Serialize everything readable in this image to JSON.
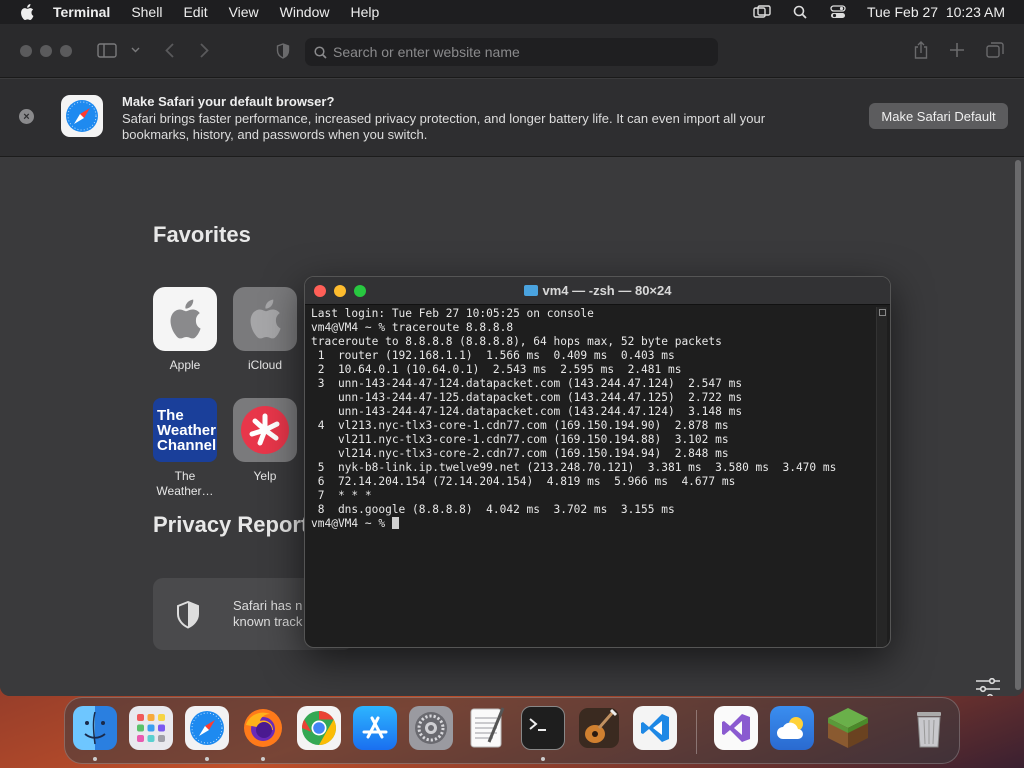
{
  "menubar": {
    "apple_icon": "apple-logo-icon",
    "items": [
      "Terminal",
      "Shell",
      "Edit",
      "View",
      "Window",
      "Help"
    ],
    "datetime": "Tue Feb 27  10:23 AM"
  },
  "safari": {
    "address_placeholder": "Search or enter website name",
    "banner": {
      "title": "Make Safari your default browser?",
      "description": "Safari brings faster performance, increased privacy protection, and longer battery life. It can even import all your bookmarks, history, and passwords when you switch.",
      "button": "Make Safari Default"
    },
    "favorites_title": "Favorites",
    "favorites": [
      {
        "label": "Apple",
        "icon": "apple-logo-icon"
      },
      {
        "label": "iCloud",
        "icon": "icloud-logo-icon"
      },
      {
        "label": "The Weather...",
        "icon": "weather-channel-icon",
        "tile_text": [
          "The",
          "Weather",
          "Channel"
        ]
      },
      {
        "label": "Yelp",
        "icon": "yelp-icon"
      }
    ],
    "privacy_title": "Privacy Report",
    "privacy_text": [
      "Safari has n",
      "known track"
    ]
  },
  "terminal": {
    "title": "vm4 — -zsh — 80×24",
    "lines": [
      "Last login: Tue Feb 27 10:05:25 on console",
      "vm4@VM4 ~ % traceroute 8.8.8.8",
      "traceroute to 8.8.8.8 (8.8.8.8), 64 hops max, 52 byte packets",
      " 1  router (192.168.1.1)  1.566 ms  0.409 ms  0.403 ms",
      " 2  10.64.0.1 (10.64.0.1)  2.543 ms  2.595 ms  2.481 ms",
      " 3  unn-143-244-47-124.datapacket.com (143.244.47.124)  2.547 ms",
      "    unn-143-244-47-125.datapacket.com (143.244.47.125)  2.722 ms",
      "    unn-143-244-47-124.datapacket.com (143.244.47.124)  3.148 ms",
      " 4  vl213.nyc-tlx3-core-1.cdn77.com (169.150.194.90)  2.878 ms",
      "    vl211.nyc-tlx3-core-1.cdn77.com (169.150.194.88)  3.102 ms",
      "    vl214.nyc-tlx3-core-2.cdn77.com (169.150.194.94)  2.848 ms",
      " 5  nyk-b8-link.ip.twelve99.net (213.248.70.121)  3.381 ms  3.580 ms  3.470 ms",
      " 6  72.14.204.154 (72.14.204.154)  4.819 ms  5.966 ms  4.677 ms",
      " 7  * * *",
      " 8  dns.google (8.8.8.8)  4.042 ms  3.702 ms  3.155 ms",
      "vm4@VM4 ~ % "
    ]
  },
  "dock": {
    "apps": [
      "Finder",
      "Launchpad",
      "Safari",
      "Firefox",
      "Chrome",
      "App Store",
      "System Settings",
      "TextEdit",
      "Terminal",
      "GarageBand",
      "Visual Studio Code",
      "Visual Studio",
      "Weather",
      "Minecraft",
      "Trash"
    ]
  }
}
